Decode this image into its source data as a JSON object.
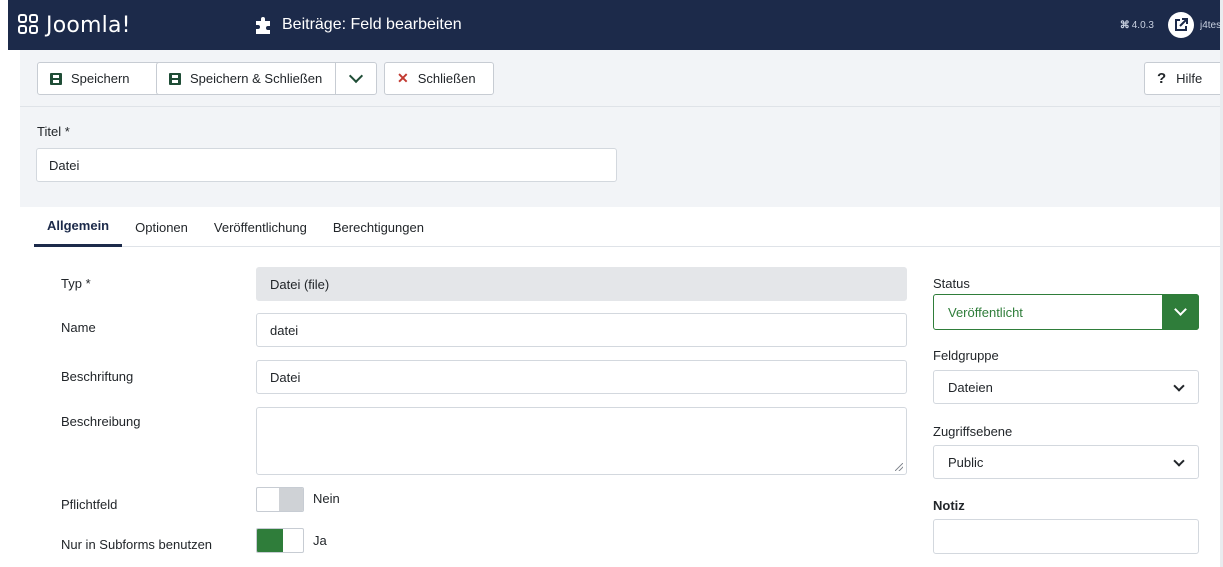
{
  "header": {
    "logo_text": "Joomla!",
    "page_title": "Beiträge: Feld bearbeiten",
    "page_icon": "puzzle-icon",
    "version": "4.0.3",
    "user_label": "j4tes"
  },
  "toolbar": {
    "save_label": "Speichern",
    "save_close_label": "Speichern & Schließen",
    "close_label": "Schließen",
    "help_label": "Hilfe"
  },
  "title": {
    "label": "Titel *",
    "value": "Datei"
  },
  "tabs": [
    {
      "label": "Allgemein",
      "active": true
    },
    {
      "label": "Optionen",
      "active": false
    },
    {
      "label": "Veröffentlichung",
      "active": false
    },
    {
      "label": "Berechtigungen",
      "active": false
    }
  ],
  "form": {
    "type_label": "Typ *",
    "type_value": "Datei (file)",
    "name_label": "Name",
    "name_value": "datei",
    "caption_label": "Beschriftung",
    "caption_value": "Datei",
    "description_label": "Beschreibung",
    "description_value": "",
    "required_label": "Pflichtfeld",
    "required_value": "Nein",
    "subform_label": "Nur in Subforms benutzen",
    "subform_value": "Ja"
  },
  "sidebar": {
    "status_label": "Status",
    "status_value": "Veröffentlicht",
    "fieldgroup_label": "Feldgruppe",
    "fieldgroup_value": "Dateien",
    "access_label": "Zugriffsebene",
    "access_value": "Public",
    "note_label": "Notiz",
    "note_value": ""
  },
  "colors": {
    "header_bg": "#1c2a4a",
    "success_green": "#2f7d3a",
    "danger_red": "#c23a31"
  }
}
